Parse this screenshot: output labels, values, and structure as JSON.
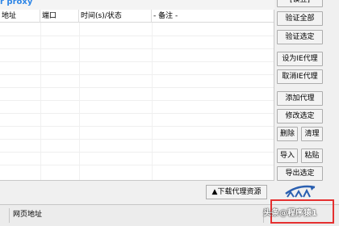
{
  "app": {
    "title": "r proxy"
  },
  "list": {
    "columns": [
      "地址",
      "端口",
      "时间(s)/状态",
      "- 备注 -"
    ]
  },
  "side_buttons": {
    "top_partial": "[误豆]",
    "verify_all": "验证全部",
    "verify_selected": "验证选定",
    "set_ie_proxy": "设为IE代理",
    "cancel_ie_proxy": "取消IE代理",
    "add_proxy": "添加代理",
    "edit_selected": "修改选定",
    "delete": "删除",
    "clean": "清理",
    "import": "导入",
    "paste": "粘贴",
    "export_selected": "导出选定"
  },
  "download_button": "▲下载代理资源",
  "status_bar": {
    "url_label": "网页地址"
  },
  "watermark": "头条@程序猿1",
  "colors": {
    "title": "#2f86e6",
    "logo": "#2a5fb0",
    "highlight": "#e53030"
  }
}
